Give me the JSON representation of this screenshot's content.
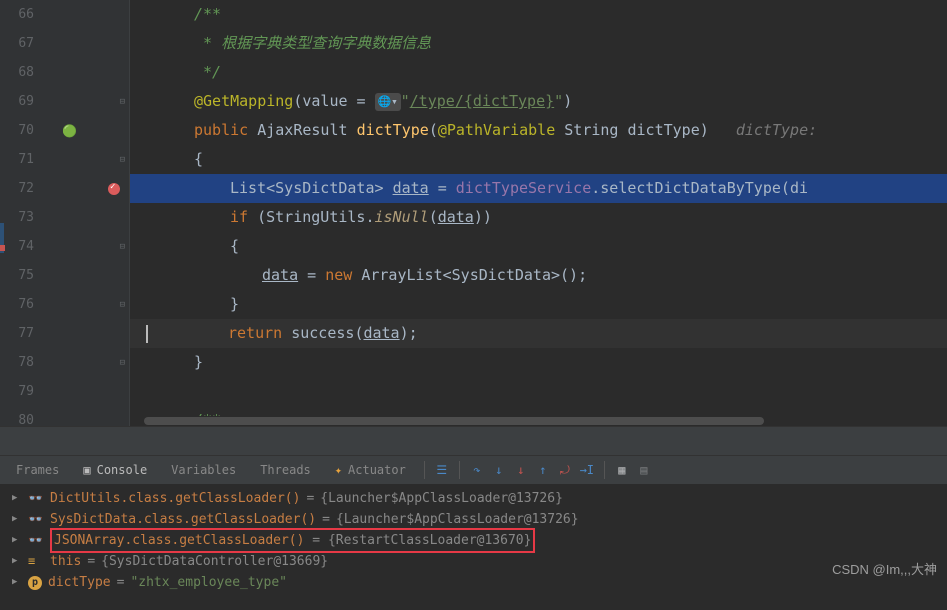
{
  "editor": {
    "lines": [
      {
        "num": 66,
        "indent": 3,
        "tokens": [
          {
            "cls": "comment",
            "t": "/**"
          }
        ]
      },
      {
        "num": 67,
        "indent": 3,
        "tokens": [
          {
            "cls": "comment",
            "t": " * 根据字典类型查询字典数据信息"
          }
        ]
      },
      {
        "num": 68,
        "indent": 3,
        "tokens": [
          {
            "cls": "comment",
            "t": " */"
          }
        ]
      },
      {
        "num": 69,
        "indent": 3
      },
      {
        "num": 70,
        "indent": 3
      },
      {
        "num": 71,
        "indent": 3,
        "tokens": [
          {
            "cls": "bright",
            "t": "{"
          }
        ]
      },
      {
        "num": 72,
        "indent": 4,
        "highlighted": true
      },
      {
        "num": 73,
        "indent": 4
      },
      {
        "num": 74,
        "indent": 4,
        "tokens": [
          {
            "cls": "bright",
            "t": "{"
          }
        ]
      },
      {
        "num": 75,
        "indent": 5
      },
      {
        "num": 76,
        "indent": 4,
        "tokens": [
          {
            "cls": "bright",
            "t": "}"
          }
        ]
      },
      {
        "num": 77,
        "indent": 4,
        "current": true
      },
      {
        "num": 78,
        "indent": 3,
        "tokens": [
          {
            "cls": "bright",
            "t": "}"
          }
        ]
      },
      {
        "num": 79,
        "indent": 0,
        "tokens": []
      },
      {
        "num": 80,
        "indent": 3,
        "tokens": [
          {
            "cls": "comment",
            "t": "/**"
          }
        ]
      }
    ],
    "line69": {
      "anno": "@GetMapping",
      "paren_o": "(",
      "value_kw": "value = ",
      "globe": "🌐▾",
      "str_o": "\"",
      "path": "/type/{dictType}",
      "str_c": "\"",
      "paren_c": ")"
    },
    "line70": {
      "kw_public": "public ",
      "type": "AjaxResult ",
      "method": "dictType",
      "paren_o": "(",
      "anno": "@PathVariable ",
      "ptype": "String ",
      "pname": "dictType",
      "paren_c": ")",
      "sp": "   ",
      "hint": "dictType:"
    },
    "line72": {
      "type1": "List",
      "lt": "<",
      "type2": "SysDictData",
      "gt": "> ",
      "var": "data",
      "eq": " = ",
      "svc": "dictTypeService",
      "dot": ".",
      "call": "selectDictDataByType",
      "paren_o": "(",
      "arg": "di"
    },
    "line73": {
      "kw": "if ",
      "po": "(",
      "cls": "StringUtils",
      "dot": ".",
      "m": "isNull",
      "po2": "(",
      "arg": "data",
      "pc": "))"
    },
    "line75": {
      "var": "data",
      "eq": " = ",
      "kw": "new ",
      "type": "ArrayList",
      "lt": "<",
      "gen": "SysDictData",
      "gt": ">();"
    },
    "line77": {
      "kw": "return ",
      "m": "success",
      "po": "(",
      "arg": "data",
      "pc": ");"
    }
  },
  "debug": {
    "tabs": {
      "frames": "Frames",
      "console": "Console",
      "variables": "Variables",
      "threads": "Threads",
      "actuator": "Actuator"
    },
    "vars": [
      {
        "icon": "glasses",
        "name": "DictUtils.class.getClassLoader()",
        "eq": " = ",
        "value": "{Launcher$AppClassLoader@13726}"
      },
      {
        "icon": "glasses",
        "name": "SysDictData.class.getClassLoader()",
        "eq": " = ",
        "value": "{Launcher$AppClassLoader@13726}"
      },
      {
        "icon": "glasses",
        "red": true,
        "name": "JSONArray.class.getClassLoader()",
        "eq": " = ",
        "value": "{RestartClassLoader@13670}"
      },
      {
        "icon": "bar",
        "name": "this",
        "eq": " = ",
        "value": "{SysDictDataController@13669}"
      },
      {
        "icon": "p",
        "name": "dictType",
        "eq": " = ",
        "str": "\"zhtx_employee_type\""
      }
    ]
  },
  "watermark": "CSDN @Im,,,大神"
}
